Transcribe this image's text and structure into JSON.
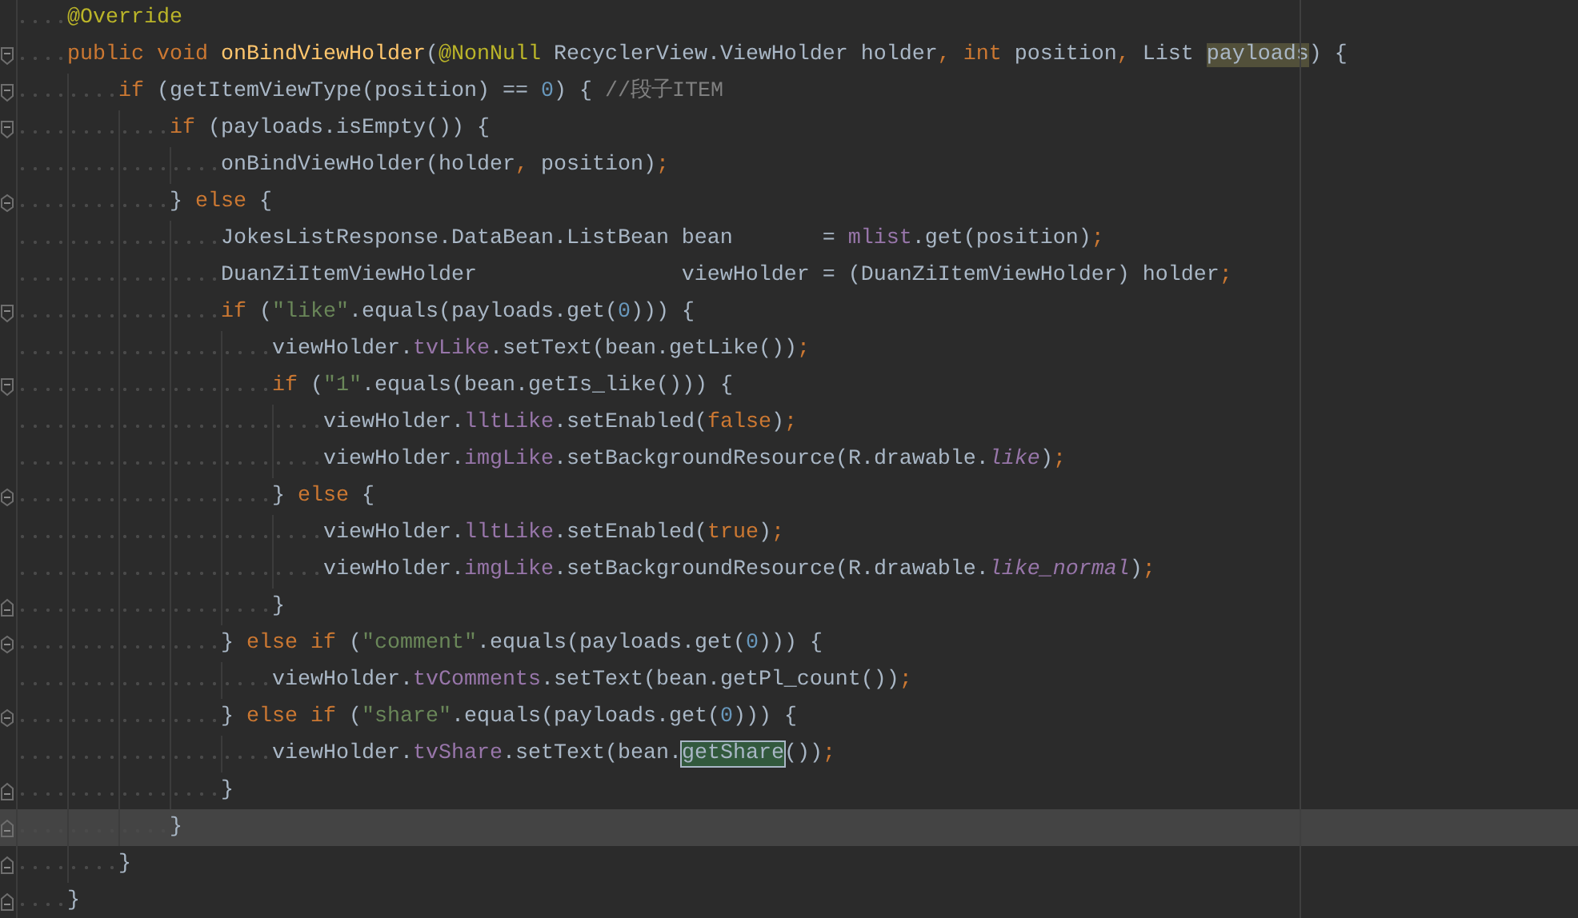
{
  "editor": {
    "lines": [
      {
        "opens": false,
        "closes": false,
        "current": false,
        "tokens": [
          {
            "kind": "annotation",
            "text": "@Override"
          }
        ]
      },
      {
        "opens": true,
        "closes": false,
        "current": false,
        "tokens": [
          {
            "kind": "keyword",
            "text": "public void "
          },
          {
            "kind": "method",
            "text": "onBindViewHolder"
          },
          {
            "kind": "plain",
            "text": "("
          },
          {
            "kind": "annotation",
            "text": "@NonNull"
          },
          {
            "kind": "plain",
            "text": " RecyclerView.ViewHolder holder"
          },
          {
            "kind": "punct",
            "text": ", "
          },
          {
            "kind": "keyword",
            "text": "int"
          },
          {
            "kind": "plain",
            "text": " position"
          },
          {
            "kind": "punct",
            "text": ", "
          },
          {
            "kind": "plain",
            "text": "List "
          },
          {
            "kind": "plain",
            "text": "payloads",
            "highlighted": true
          },
          {
            "kind": "plain",
            "text": ") {"
          }
        ]
      },
      {
        "opens": true,
        "closes": false,
        "current": false,
        "tokens": [
          {
            "kind": "keyword",
            "text": "if"
          },
          {
            "kind": "plain",
            "text": " (getItemViewType(position) == "
          },
          {
            "kind": "number",
            "text": "0"
          },
          {
            "kind": "plain",
            "text": ") { "
          },
          {
            "kind": "comment",
            "text": "//段子ITEM"
          }
        ]
      },
      {
        "opens": true,
        "closes": false,
        "current": false,
        "tokens": [
          {
            "kind": "keyword",
            "text": "if"
          },
          {
            "kind": "plain",
            "text": " (payloads.isEmpty()) {"
          }
        ]
      },
      {
        "opens": false,
        "closes": false,
        "current": false,
        "tokens": [
          {
            "kind": "plain",
            "text": "onBindViewHolder(holder"
          },
          {
            "kind": "punct",
            "text": ", "
          },
          {
            "kind": "plain",
            "text": "position)"
          },
          {
            "kind": "punct",
            "text": ";"
          }
        ]
      },
      {
        "opens": true,
        "closes": true,
        "current": false,
        "tokens": [
          {
            "kind": "plain",
            "text": "} "
          },
          {
            "kind": "keyword",
            "text": "else"
          },
          {
            "kind": "plain",
            "text": " {"
          }
        ]
      },
      {
        "opens": false,
        "closes": false,
        "current": false,
        "tokens": [
          {
            "kind": "plain",
            "text": "JokesListResponse.DataBean.ListBean bean       = "
          },
          {
            "kind": "field",
            "text": "mlist"
          },
          {
            "kind": "plain",
            "text": ".get(position)"
          },
          {
            "kind": "punct",
            "text": ";"
          }
        ]
      },
      {
        "opens": false,
        "closes": false,
        "current": false,
        "tokens": [
          {
            "kind": "plain",
            "text": "DuanZiItemViewHolder                viewHolder = (DuanZiItemViewHolder) holder"
          },
          {
            "kind": "punct",
            "text": ";"
          }
        ]
      },
      {
        "opens": true,
        "closes": false,
        "current": false,
        "tokens": [
          {
            "kind": "keyword",
            "text": "if"
          },
          {
            "kind": "plain",
            "text": " ("
          },
          {
            "kind": "string",
            "text": "\"like\""
          },
          {
            "kind": "plain",
            "text": ".equals(payloads.get("
          },
          {
            "kind": "number",
            "text": "0"
          },
          {
            "kind": "plain",
            "text": "))) {"
          }
        ]
      },
      {
        "opens": false,
        "closes": false,
        "current": false,
        "tokens": [
          {
            "kind": "plain",
            "text": "viewHolder."
          },
          {
            "kind": "field",
            "text": "tvLike"
          },
          {
            "kind": "plain",
            "text": ".setText(bean.getLike())"
          },
          {
            "kind": "punct",
            "text": ";"
          }
        ]
      },
      {
        "opens": true,
        "closes": false,
        "current": false,
        "tokens": [
          {
            "kind": "keyword",
            "text": "if"
          },
          {
            "kind": "plain",
            "text": " ("
          },
          {
            "kind": "string",
            "text": "\"1\""
          },
          {
            "kind": "plain",
            "text": ".equals(bean.getIs_like())) {"
          }
        ]
      },
      {
        "opens": false,
        "closes": false,
        "current": false,
        "tokens": [
          {
            "kind": "plain",
            "text": "viewHolder."
          },
          {
            "kind": "field",
            "text": "lltLike"
          },
          {
            "kind": "plain",
            "text": ".setEnabled("
          },
          {
            "kind": "keyword",
            "text": "false"
          },
          {
            "kind": "plain",
            "text": ")"
          },
          {
            "kind": "punct",
            "text": ";"
          }
        ]
      },
      {
        "opens": false,
        "closes": false,
        "current": false,
        "tokens": [
          {
            "kind": "plain",
            "text": "viewHolder."
          },
          {
            "kind": "field",
            "text": "imgLike"
          },
          {
            "kind": "plain",
            "text": ".setBackgroundResource(R.drawable."
          },
          {
            "kind": "static",
            "text": "like"
          },
          {
            "kind": "plain",
            "text": ")"
          },
          {
            "kind": "punct",
            "text": ";"
          }
        ]
      },
      {
        "opens": true,
        "closes": true,
        "current": false,
        "tokens": [
          {
            "kind": "plain",
            "text": "} "
          },
          {
            "kind": "keyword",
            "text": "else"
          },
          {
            "kind": "plain",
            "text": " {"
          }
        ]
      },
      {
        "opens": false,
        "closes": false,
        "current": false,
        "tokens": [
          {
            "kind": "plain",
            "text": "viewHolder."
          },
          {
            "kind": "field",
            "text": "lltLike"
          },
          {
            "kind": "plain",
            "text": ".setEnabled("
          },
          {
            "kind": "keyword",
            "text": "true"
          },
          {
            "kind": "plain",
            "text": ")"
          },
          {
            "kind": "punct",
            "text": ";"
          }
        ]
      },
      {
        "opens": false,
        "closes": false,
        "current": false,
        "tokens": [
          {
            "kind": "plain",
            "text": "viewHolder."
          },
          {
            "kind": "field",
            "text": "imgLike"
          },
          {
            "kind": "plain",
            "text": ".setBackgroundResource(R.drawable."
          },
          {
            "kind": "static",
            "text": "like_normal"
          },
          {
            "kind": "plain",
            "text": ")"
          },
          {
            "kind": "punct",
            "text": ";"
          }
        ]
      },
      {
        "opens": false,
        "closes": true,
        "current": false,
        "tokens": [
          {
            "kind": "plain",
            "text": "}"
          }
        ]
      },
      {
        "opens": true,
        "closes": true,
        "current": false,
        "tokens": [
          {
            "kind": "plain",
            "text": "} "
          },
          {
            "kind": "keyword",
            "text": "else if"
          },
          {
            "kind": "plain",
            "text": " ("
          },
          {
            "kind": "string",
            "text": "\"comment\""
          },
          {
            "kind": "plain",
            "text": ".equals(payloads.get("
          },
          {
            "kind": "number",
            "text": "0"
          },
          {
            "kind": "plain",
            "text": "))) {"
          }
        ]
      },
      {
        "opens": false,
        "closes": false,
        "current": false,
        "tokens": [
          {
            "kind": "plain",
            "text": "viewHolder."
          },
          {
            "kind": "field",
            "text": "tvComments"
          },
          {
            "kind": "plain",
            "text": ".setText(bean.getPl_count())"
          },
          {
            "kind": "punct",
            "text": ";"
          }
        ]
      },
      {
        "opens": true,
        "closes": true,
        "current": false,
        "tokens": [
          {
            "kind": "plain",
            "text": "} "
          },
          {
            "kind": "keyword",
            "text": "else if"
          },
          {
            "kind": "plain",
            "text": " ("
          },
          {
            "kind": "string",
            "text": "\"share\""
          },
          {
            "kind": "plain",
            "text": ".equals(payloads.get("
          },
          {
            "kind": "number",
            "text": "0"
          },
          {
            "kind": "plain",
            "text": "))) {"
          }
        ]
      },
      {
        "opens": false,
        "closes": false,
        "current": false,
        "tokens": [
          {
            "kind": "plain",
            "text": "viewHolder."
          },
          {
            "kind": "field",
            "text": "tvShare"
          },
          {
            "kind": "plain",
            "text": ".setText(bean."
          },
          {
            "kind": "plain",
            "text": "getShare",
            "boxed": true
          },
          {
            "kind": "plain",
            "text": "())"
          },
          {
            "kind": "punct",
            "text": ";"
          }
        ]
      },
      {
        "opens": false,
        "closes": true,
        "current": false,
        "tokens": [
          {
            "kind": "plain",
            "text": "}"
          }
        ]
      },
      {
        "opens": false,
        "closes": true,
        "current": true,
        "tokens": [
          {
            "kind": "plain",
            "text": "}"
          }
        ]
      },
      {
        "opens": false,
        "closes": true,
        "current": false,
        "tokens": [
          {
            "kind": "plain",
            "text": "}"
          }
        ]
      },
      {
        "opens": false,
        "closes": true,
        "current": false,
        "tokens": [
          {
            "kind": "plain",
            "text": "}"
          }
        ]
      }
    ]
  }
}
